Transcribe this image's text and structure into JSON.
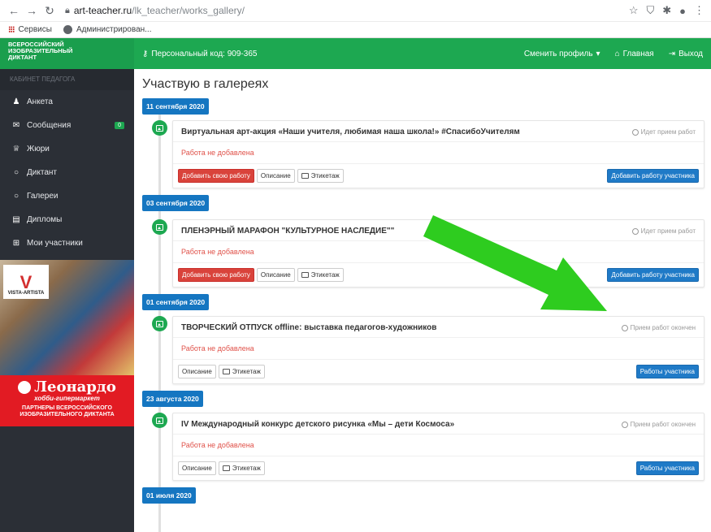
{
  "browser": {
    "url_host": "art-teacher.ru",
    "url_path": "/lk_teacher/works_gallery/",
    "bookmarks": [
      "Сервисы",
      "Администрирован..."
    ]
  },
  "brand": {
    "line1": "ВСЕРОССИЙСКИЙ",
    "line2": "ИЗОБРАЗИТЕЛЬНЫЙ",
    "line3": "ДИКТАНТ"
  },
  "topnav": {
    "code_label": "Персональный код: 909-365",
    "switch_profile": "Сменить профиль",
    "home": "Главная",
    "logout": "Выход"
  },
  "sidebar": {
    "header": "КАБИНЕТ ПЕДАГОГА",
    "items": [
      {
        "label": "Анкета"
      },
      {
        "label": "Сообщения",
        "badge": "0"
      },
      {
        "label": "Жюри"
      },
      {
        "label": "Диктант"
      },
      {
        "label": "Галереи"
      },
      {
        "label": "Дипломы"
      },
      {
        "label": "Мои участники"
      }
    ],
    "ad": {
      "logo_text": "VISTA-ARTISTA",
      "brand": "Леонардо",
      "subtitle": "хобби-гипермаркет",
      "partners_line1": "ПАРТНЕРЫ ВСЕРОССИЙСКОГО",
      "partners_line2": "ИЗОБРАЗИТЕЛЬНОГО ДИКТАНТА"
    }
  },
  "main": {
    "title": "Участвую в галереях",
    "buttons": {
      "add_own": "Добавить свою работу",
      "description": "Описание",
      "label": "Этикетаж",
      "add_participant": "Добавить работу участника",
      "participant_works": "Работы участника"
    },
    "entries": [
      {
        "date": "11 сентября 2020",
        "title": "Виртуальная арт-акция «Наши учителя, любимая наша школа!» #СпасибоУчителям",
        "status": "Идет прием работ",
        "body": "Работа не добавлена"
      },
      {
        "date": "03 сентября 2020",
        "title": "ПЛЕНЭРНЫЙ МАРАФОН \"КУЛЬТУРНОЕ НАСЛЕДИЕ\"\"",
        "status": "Идет прием работ",
        "body": "Работа не добавлена"
      },
      {
        "date": "01 сентября 2020",
        "title": "ТВОРЧЕСКИЙ ОТПУСК offline: выставка педагогов-художников",
        "status": "Прием работ окончен",
        "body": "Работа не добавлена"
      },
      {
        "date": "23 августа 2020",
        "title": "IV Международный конкурс детского рисунка «Мы – дети Космоса»",
        "status": "Прием работ окончен",
        "body": "Работа не добавлена"
      }
    ],
    "last_date": "01 июля 2020"
  },
  "colors": {
    "green": "#1da851",
    "blue": "#1576c1",
    "red": "#d9433b",
    "arrow": "#2ecc1f"
  }
}
